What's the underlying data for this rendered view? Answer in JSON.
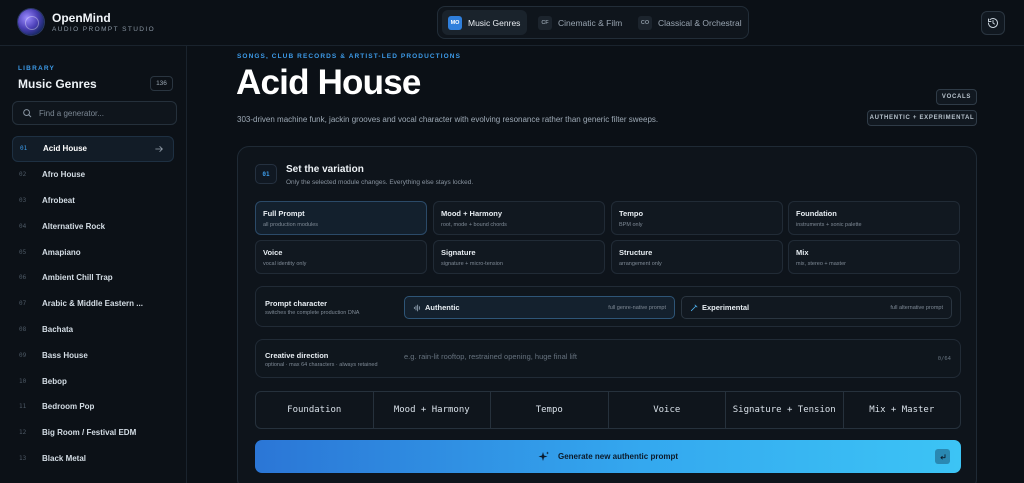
{
  "app": {
    "name": "OpenMind",
    "subtitle": "AUDIO PROMPT STUDIO"
  },
  "tabs": [
    {
      "code": "MO",
      "label": "Music Genres",
      "active": true
    },
    {
      "code": "CF",
      "label": "Cinematic & Film",
      "active": false
    },
    {
      "code": "CO",
      "label": "Classical & Orchestral",
      "active": false
    }
  ],
  "sidebar": {
    "section_label": "LIBRARY",
    "title": "Music Genres",
    "count": "136",
    "search_placeholder": "Find a generator...",
    "items": [
      {
        "num": "01",
        "label": "Acid House"
      },
      {
        "num": "02",
        "label": "Afro House"
      },
      {
        "num": "03",
        "label": "Afrobeat"
      },
      {
        "num": "04",
        "label": "Alternative Rock"
      },
      {
        "num": "05",
        "label": "Amapiano"
      },
      {
        "num": "06",
        "label": "Ambient Chill Trap"
      },
      {
        "num": "07",
        "label": "Arabic & Middle Eastern ..."
      },
      {
        "num": "08",
        "label": "Bachata"
      },
      {
        "num": "09",
        "label": "Bass House"
      },
      {
        "num": "10",
        "label": "Bebop"
      },
      {
        "num": "11",
        "label": "Bedroom Pop"
      },
      {
        "num": "12",
        "label": "Big Room / Festival EDM"
      },
      {
        "num": "13",
        "label": "Black Metal"
      }
    ]
  },
  "main": {
    "eyebrow": "SONGS, CLUB RECORDS & ARTIST-LED PRODUCTIONS",
    "title": "Acid House",
    "description": "303-driven machine funk, jackin grooves and vocal character with evolving resonance rather than generic filter sweeps.",
    "badges": [
      "VOCALS",
      "AUTHENTIC + EXPERIMENTAL"
    ]
  },
  "variation": {
    "step": "01",
    "title": "Set the variation",
    "subtitle": "Only the selected module changes. Everything else stays locked.",
    "modules": [
      {
        "title": "Full Prompt",
        "sub": "all production modules",
        "active": true
      },
      {
        "title": "Mood + Harmony",
        "sub": "root, mode + bound chords",
        "active": false
      },
      {
        "title": "Tempo",
        "sub": "BPM only",
        "active": false
      },
      {
        "title": "Foundation",
        "sub": "instruments + sonic palette",
        "active": false
      },
      {
        "title": "Voice",
        "sub": "vocal identity only",
        "active": false
      },
      {
        "title": "Signature",
        "sub": "signature + micro-tension",
        "active": false
      },
      {
        "title": "Structure",
        "sub": "arrangement only",
        "active": false
      },
      {
        "title": "Mix",
        "sub": "mix, stereo + master",
        "active": false
      }
    ]
  },
  "character": {
    "title": "Prompt character",
    "subtitle": "switches the complete production DNA",
    "options": [
      {
        "label": "Authentic",
        "sub": "full genre-native prompt",
        "active": true
      },
      {
        "label": "Experimental",
        "sub": "full alternative prompt",
        "active": false
      }
    ]
  },
  "direction": {
    "title": "Creative direction",
    "subtitle": "optional · max 64 characters · always retained",
    "placeholder": "e.g. rain-lit rooftop, restrained opening, huge final lift",
    "counter": "0/64"
  },
  "segments": [
    "Foundation",
    "Mood + Harmony",
    "Tempo",
    "Voice",
    "Signature + Tension",
    "Mix + Master"
  ],
  "generate": {
    "label": "Generate new authentic prompt"
  },
  "colors": {
    "accent": "#3d9be9",
    "active_tab": "#2f7fdc",
    "button_start": "#2b76d6",
    "button_end": "#3cc4f5"
  },
  "icons": {
    "history": "history-icon",
    "search": "search-icon",
    "arrow": "arrow-right-icon",
    "authentic": "waveform-icon",
    "experimental": "pen-icon",
    "generate": "sparkle-icon",
    "enter": "enter-key-icon"
  }
}
